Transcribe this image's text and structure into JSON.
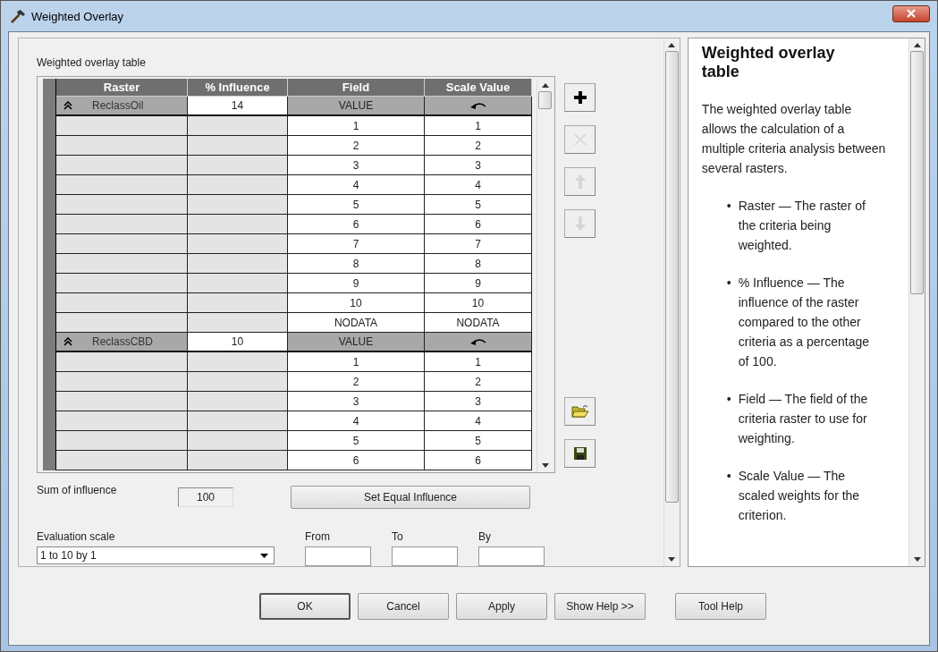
{
  "window": {
    "title": "Weighted Overlay"
  },
  "table_panel": {
    "label": "Weighted overlay table"
  },
  "table": {
    "columns": [
      "Raster",
      "% Influence",
      "Field",
      "Scale Value"
    ],
    "groups": [
      {
        "raster": "ReclassOil",
        "influence": "14",
        "field": "VALUE",
        "expanded": true,
        "rows": [
          {
            "field": "1",
            "scale_value": "1"
          },
          {
            "field": "2",
            "scale_value": "2"
          },
          {
            "field": "3",
            "scale_value": "3"
          },
          {
            "field": "4",
            "scale_value": "4"
          },
          {
            "field": "5",
            "scale_value": "5"
          },
          {
            "field": "6",
            "scale_value": "6"
          },
          {
            "field": "7",
            "scale_value": "7"
          },
          {
            "field": "8",
            "scale_value": "8"
          },
          {
            "field": "9",
            "scale_value": "9"
          },
          {
            "field": "10",
            "scale_value": "10"
          },
          {
            "field": "NODATA",
            "scale_value": "NODATA"
          }
        ]
      },
      {
        "raster": "ReclassCBD",
        "influence": "10",
        "field": "VALUE",
        "expanded": true,
        "rows": [
          {
            "field": "1",
            "scale_value": "1"
          },
          {
            "field": "2",
            "scale_value": "2"
          },
          {
            "field": "3",
            "scale_value": "3"
          },
          {
            "field": "4",
            "scale_value": "4"
          },
          {
            "field": "5",
            "scale_value": "5"
          },
          {
            "field": "6",
            "scale_value": "6"
          }
        ]
      }
    ]
  },
  "row_tools": [
    {
      "kind": "add",
      "disabled": false
    },
    {
      "kind": "remove",
      "disabled": true
    },
    {
      "kind": "up",
      "disabled": true
    },
    {
      "kind": "down",
      "disabled": true
    }
  ],
  "file_tools": [
    {
      "kind": "open",
      "disabled": false
    },
    {
      "kind": "save",
      "disabled": false
    }
  ],
  "sum_of_influence": {
    "label": "Sum of influence",
    "value": "100"
  },
  "set_equal_button": "Set Equal Influence",
  "evaluation_scale": {
    "label": "Evaluation scale",
    "value": "1 to 10 by 1"
  },
  "range_fields": [
    {
      "label": "From"
    },
    {
      "label": "To"
    },
    {
      "label": "By"
    }
  ],
  "help": {
    "title": "Weighted overlay table",
    "intro": "The weighted overlay table allows the calculation of a multiple criteria analysis between several rasters.",
    "items": [
      {
        "marker": "•",
        "text": "Raster — The raster of the criteria being weighted."
      },
      {
        "marker": "•",
        "text": "% Influence — The influence of the raster compared to the other criteria as a percentage of 100."
      },
      {
        "marker": "•",
        "text": "Field — The field of the criteria raster to use for weighting."
      },
      {
        "marker": "•",
        "text": "Scale Value — The scaled weights for the criterion."
      }
    ]
  },
  "buttons": [
    {
      "label": "OK",
      "default": true
    },
    {
      "label": "Cancel",
      "default": false
    },
    {
      "label": "Apply",
      "default": false
    },
    {
      "label": "Show Help >>",
      "default": false
    },
    {
      "label": "Tool Help",
      "default": false
    }
  ]
}
